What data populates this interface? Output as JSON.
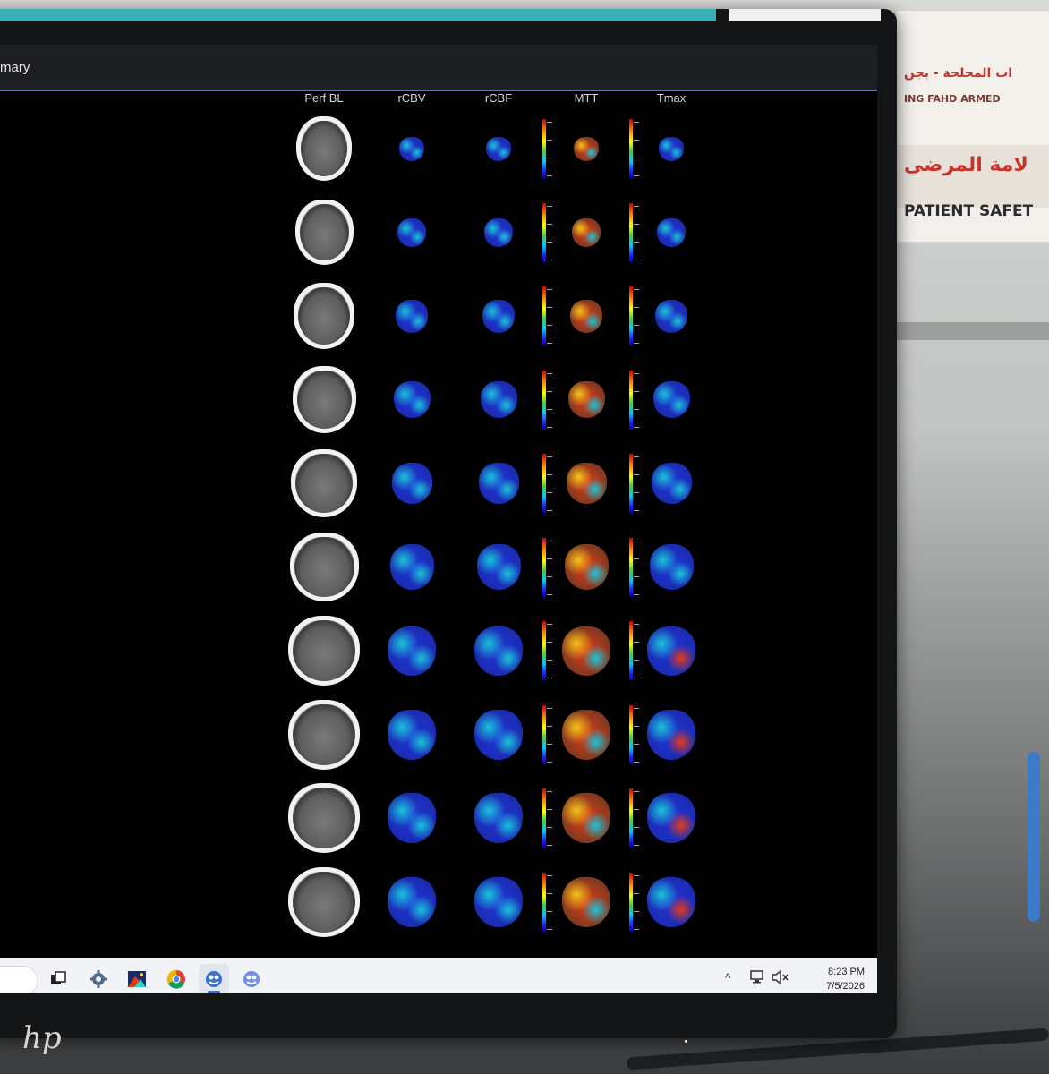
{
  "window": {
    "title_fragment": "mary"
  },
  "columns": [
    "Perf BL",
    "rCBV",
    "rCBF",
    "MTT",
    "Tmax"
  ],
  "slice_count": 10,
  "colors": {
    "titlebar": "#1e1f22",
    "accent": "#5e72c8",
    "taskbar": "#f1f3f6",
    "perfusion_low": "#2235d8",
    "perfusion_mid": "#19c3d8",
    "perfusion_high": "#e23a1a"
  },
  "taskbar": {
    "apps": [
      {
        "name": "task-view-icon"
      },
      {
        "name": "settings-gear-icon"
      },
      {
        "name": "image-viewer-icon"
      },
      {
        "name": "chrome-icon"
      },
      {
        "name": "perfusion-app-icon",
        "active": true
      },
      {
        "name": "perfusion-app-icon-2"
      }
    ],
    "tray": {
      "chevron": "^",
      "network": "network-icon",
      "volume": "volume-muted-icon"
    },
    "clock": {
      "time": "8:23 PM",
      "date": "7/5/2026"
    }
  },
  "bezel": {
    "brand": "hp"
  },
  "background_sign": {
    "line1": "ات المحلحة - بجن",
    "line2": "ING FAHD ARMED",
    "line3": "لامة المرضى",
    "line4": "PATIENT SAFET"
  }
}
